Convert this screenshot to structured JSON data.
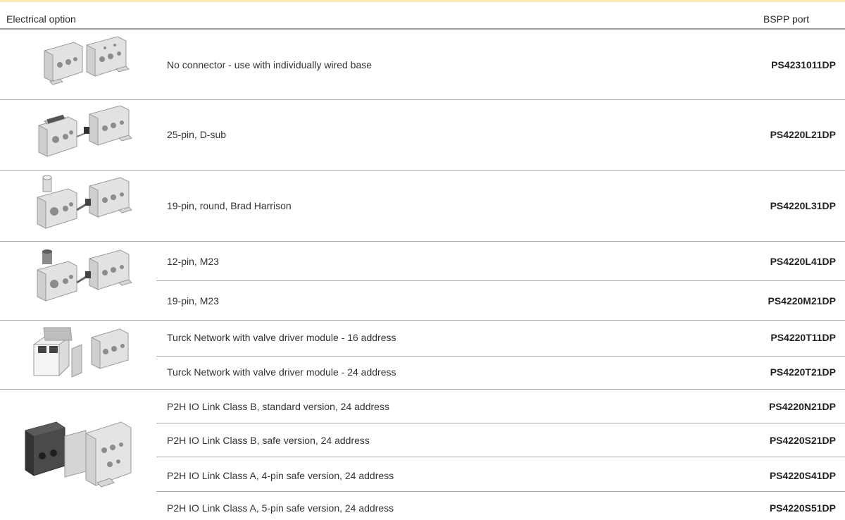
{
  "header": {
    "col_option": "Electrical option",
    "col_port": "BSPP port"
  },
  "groups": [
    {
      "image": "base-block-pair-icon",
      "rows": [
        {
          "desc": "No connector - use with individually wired base",
          "code": "PS4231011DP"
        }
      ]
    },
    {
      "image": "dsub-connector-base-icon",
      "rows": [
        {
          "desc": "25-pin, D-sub",
          "code": "PS4220L21DP"
        }
      ]
    },
    {
      "image": "round-connector-base-icon",
      "rows": [
        {
          "desc": "19-pin, round, Brad Harrison",
          "code": "PS4220L31DP"
        }
      ]
    },
    {
      "image": "m23-connector-base-icon",
      "rows": [
        {
          "desc": "12-pin, M23",
          "code": "PS4220L41DP"
        },
        {
          "desc": "19-pin, M23",
          "code": "PS4220M21DP"
        }
      ]
    },
    {
      "image": "turck-module-base-icon",
      "rows": [
        {
          "desc": "Turck Network with valve driver module - 16 address",
          "code": "PS4220T11DP"
        },
        {
          "desc": "Turck Network with valve driver module - 24 address",
          "code": "PS4220T21DP"
        }
      ]
    },
    {
      "image": "io-link-module-base-icon",
      "rows": [
        {
          "desc": "P2H IO Link Class B, standard version, 24 address",
          "code": "PS4220N21DP"
        },
        {
          "desc": "P2H IO Link Class B, safe version, 24 address",
          "code": "PS4220S21DP"
        },
        {
          "desc": "P2H IO Link Class A, 4-pin safe version, 24 address",
          "code": "PS4220S41DP"
        },
        {
          "desc": "P2H IO Link Class A, 5-pin safe version, 24 address",
          "code": "PS4220S51DP"
        }
      ]
    }
  ]
}
